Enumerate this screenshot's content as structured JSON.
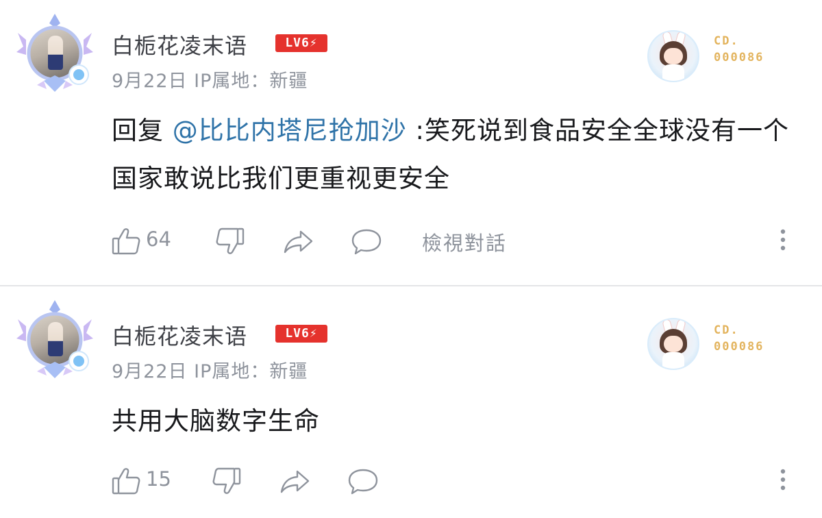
{
  "comments": [
    {
      "username": "白栀花凌末语",
      "level": "LV6",
      "meta": "9月22日  IP属地：新疆",
      "fan_label_line1": "CD.",
      "fan_label_line2": "000086",
      "reply_prefix": "回复 ",
      "mention": "@比比内塔尼抢加沙",
      "text": " :笑死说到食品安全全球没有一个国家敢说比我们更重视更安全",
      "like_count": "64",
      "view_conversation": "檢視對話"
    },
    {
      "username": "白栀花凌末语",
      "level": "LV6",
      "meta": "9月22日  IP属地：新疆",
      "fan_label_line1": "CD.",
      "fan_label_line2": "000086",
      "text": "共用大脑数字生命",
      "like_count": "15"
    }
  ],
  "icons": {
    "like": "thumbs-up-icon",
    "dislike": "thumbs-down-icon",
    "share": "share-icon",
    "reply": "comment-icon",
    "more": "more-vertical-icon",
    "level": "lightning-icon"
  },
  "colors": {
    "mention": "#2f73a8",
    "level_badge": "#e5322d",
    "fan_label": "#e3b45e",
    "secondary_text": "#8e939c"
  }
}
